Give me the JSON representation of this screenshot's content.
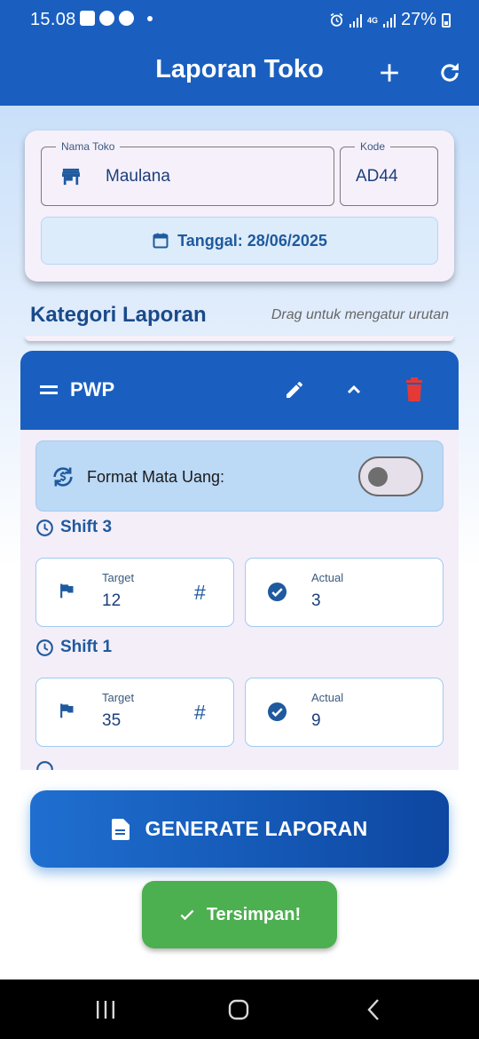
{
  "status_bar": {
    "time": "15.08",
    "network": "4G",
    "battery": "27%"
  },
  "app_bar": {
    "title": "Laporan Toko"
  },
  "store": {
    "name_label": "Nama Toko",
    "name_value": "Maulana",
    "code_label": "Kode",
    "code_value": "AD44",
    "date_text": "Tanggal: 28/06/2025"
  },
  "section": {
    "title": "Kategori Laporan",
    "hint": "Drag untuk mengatur urutan"
  },
  "category": {
    "name": "PWP",
    "currency_label": "Format Mata Uang:",
    "currency_enabled": false,
    "shifts": [
      {
        "title": "Shift 3",
        "target_label": "Target",
        "target": "12",
        "actual_label": "Actual",
        "actual": "3"
      },
      {
        "title": "Shift 1",
        "target_label": "Target",
        "target": "35",
        "actual_label": "Actual",
        "actual": "9"
      }
    ]
  },
  "generate_button": {
    "label": "GENERATE LAPORAN"
  },
  "toast": {
    "label": "Tersimpan!"
  },
  "colors": {
    "primary": "#1a5fc0",
    "danger": "#e53935",
    "success": "#4caf50",
    "card_bg": "#f6f0fb"
  }
}
